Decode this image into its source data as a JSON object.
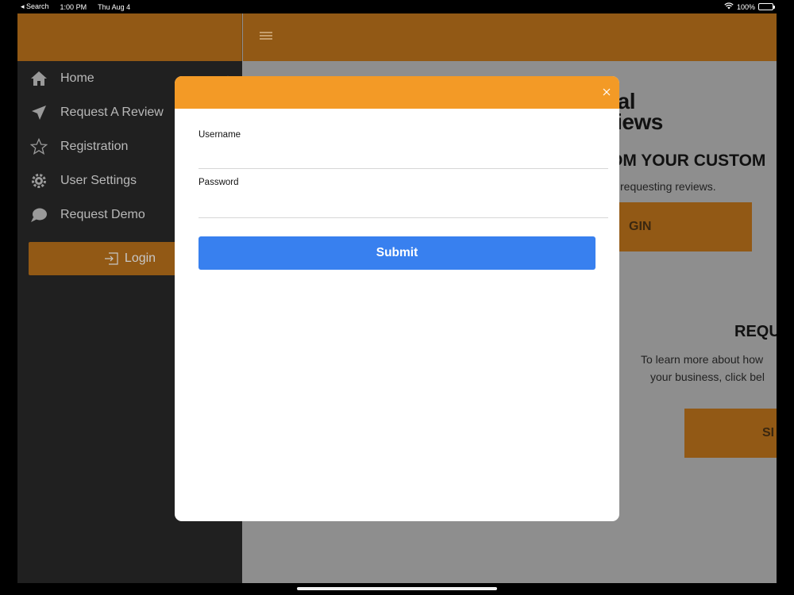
{
  "status_bar": {
    "back_label": "◂ Search",
    "time": "1:00 PM",
    "date": "Thu Aug 4",
    "battery": "100%"
  },
  "sidebar": {
    "items": [
      {
        "label": "Home",
        "icon": "home-icon"
      },
      {
        "label": "Request A Review",
        "icon": "send-icon"
      },
      {
        "label": "Registration",
        "icon": "star-icon"
      },
      {
        "label": "User Settings",
        "icon": "gear-icon"
      },
      {
        "label": "Request Demo",
        "icon": "chat-icon"
      }
    ],
    "login_label": "Login"
  },
  "main": {
    "logo_line1": "ocal",
    "logo_line2": "eviews",
    "heading": "OM YOUR CUSTOM",
    "sub": "requesting reviews.",
    "button1": "GIN",
    "heading2": "REQU",
    "text2_line1": "To learn more about how",
    "text2_line2": "your business, click bel",
    "button2": "SI"
  },
  "modal": {
    "username_label": "Username",
    "password_label": "Password",
    "username_value": "",
    "password_value": "",
    "submit_label": "Submit"
  },
  "colors": {
    "header_orange": "#f39a26",
    "submit_blue": "#3880ef",
    "sidebar_bg": "#202020"
  }
}
